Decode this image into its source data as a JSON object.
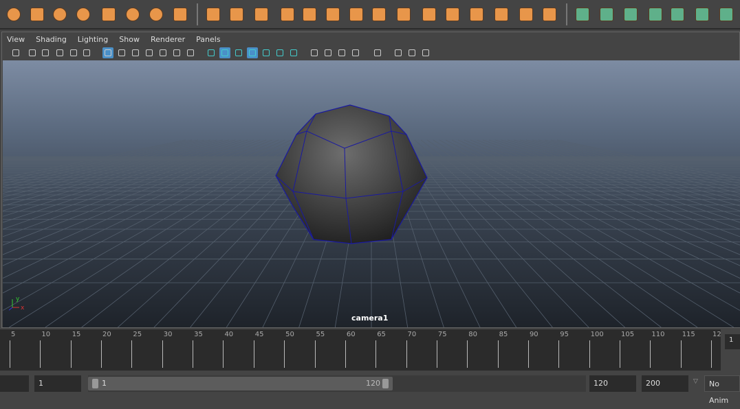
{
  "shelf": {
    "icons": [
      "sphere-icon",
      "cube-icon",
      "cylinder-icon",
      "cone-icon",
      "plane-icon",
      "torus-icon",
      "pyramid-icon",
      "pipe-icon",
      "combine-icon",
      "separate-icon",
      "extract-icon",
      "smooth-icon",
      "bevel-icon",
      "subdivide-icon",
      "multi-cut-icon",
      "extrude-icon",
      "bridge-icon",
      "bevel-cube-icon",
      "uv-planar-icon",
      "uv-cylindrical-icon",
      "uv-automatic-icon",
      "uv-editor-icon",
      "merge-icon",
      "mirror-icon",
      "planar-map-icon",
      "cylindrical-map-icon",
      "spherical-map-icon",
      "automatic-map-icon",
      "contour-stretch-icon",
      "uv-editor-window-icon",
      "unfold-icon"
    ],
    "orange": "#e8964a",
    "green": "#5fb08a"
  },
  "panel": {
    "menu": [
      "View",
      "Shading",
      "Lighting",
      "Show",
      "Renderer",
      "Panels"
    ],
    "accent": "#4a90c8"
  },
  "viewport": {
    "camera_label": "camera1",
    "axis": {
      "x": "x",
      "y": "y"
    }
  },
  "timeline": {
    "labels": [
      5,
      10,
      15,
      20,
      25,
      30,
      35,
      40,
      45,
      50,
      55,
      60,
      65,
      70,
      75,
      80,
      85,
      90,
      95,
      100,
      105,
      110,
      115,
      "12"
    ],
    "current_frame": "1"
  },
  "range": {
    "start_field": "1",
    "range_start": "1",
    "range_end": "120",
    "end_field": "120",
    "anim_end": "200",
    "anim_layer": "No Anim"
  }
}
